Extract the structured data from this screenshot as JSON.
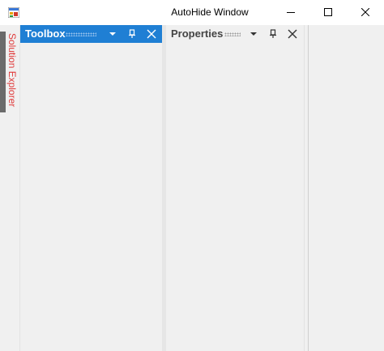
{
  "window": {
    "title": "AutoHide Window"
  },
  "autohide": {
    "label": "Solution Explorer",
    "label_color": "#e03a3a"
  },
  "panels": {
    "toolbox": {
      "title": "Toolbox",
      "state": "active",
      "accent": "#1f7fd4",
      "buttons": [
        "dropdown-icon",
        "pin-icon",
        "close-icon"
      ]
    },
    "properties": {
      "title": "Properties",
      "state": "inactive",
      "buttons": [
        "dropdown-icon",
        "pin-icon",
        "close-icon"
      ]
    }
  }
}
